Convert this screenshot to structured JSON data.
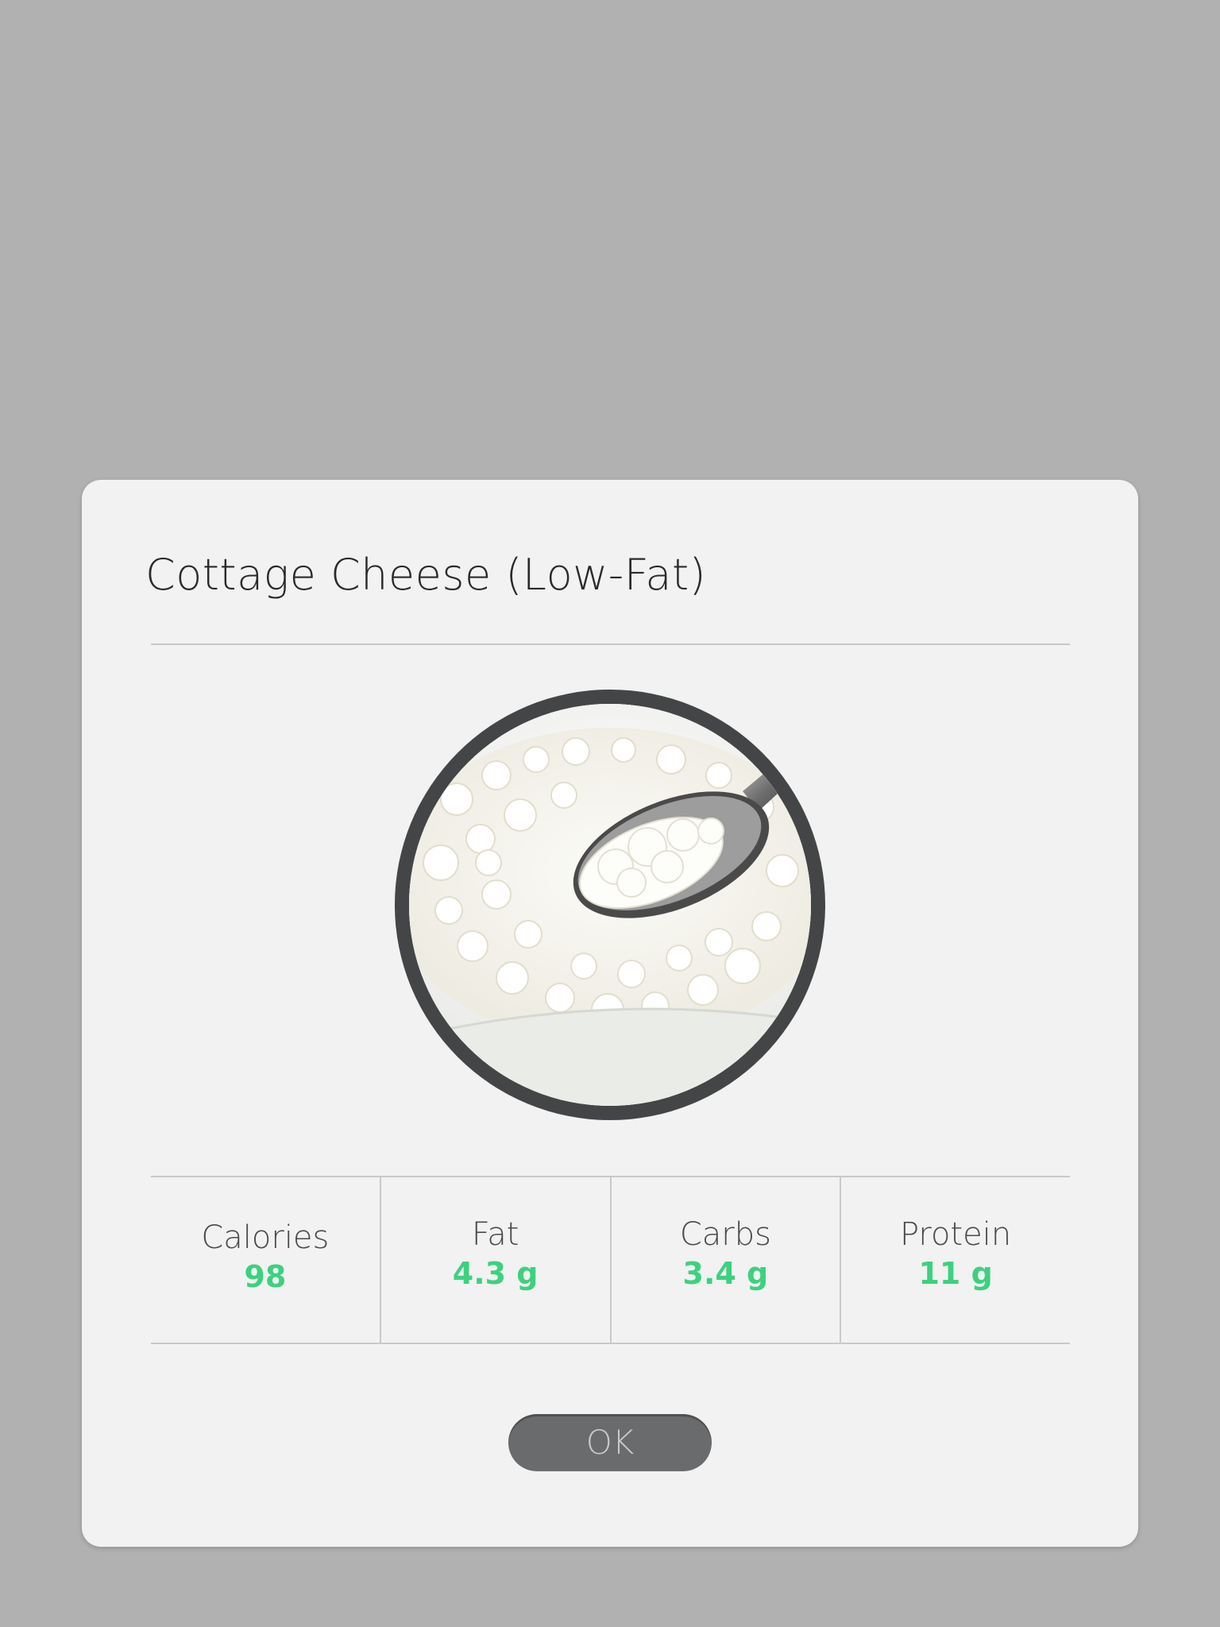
{
  "dialog": {
    "title": "Cottage Cheese (Low-Fat)",
    "image_alt": "cottage-cheese-bowl-with-spoon",
    "nutrients": [
      {
        "label": "Calories",
        "value": "98"
      },
      {
        "label": "Fat",
        "value": "4.3 g"
      },
      {
        "label": "Carbs",
        "value": "3.4 g"
      },
      {
        "label": "Protein",
        "value": "11 g"
      }
    ],
    "ok_label": "OK"
  },
  "colors": {
    "backdrop": "#b1b1b1",
    "dialog_background": "#f1f2f1",
    "accent_value": "#3dd17f",
    "button_background": "#6a6b6d",
    "photo_ring": "#444546"
  }
}
